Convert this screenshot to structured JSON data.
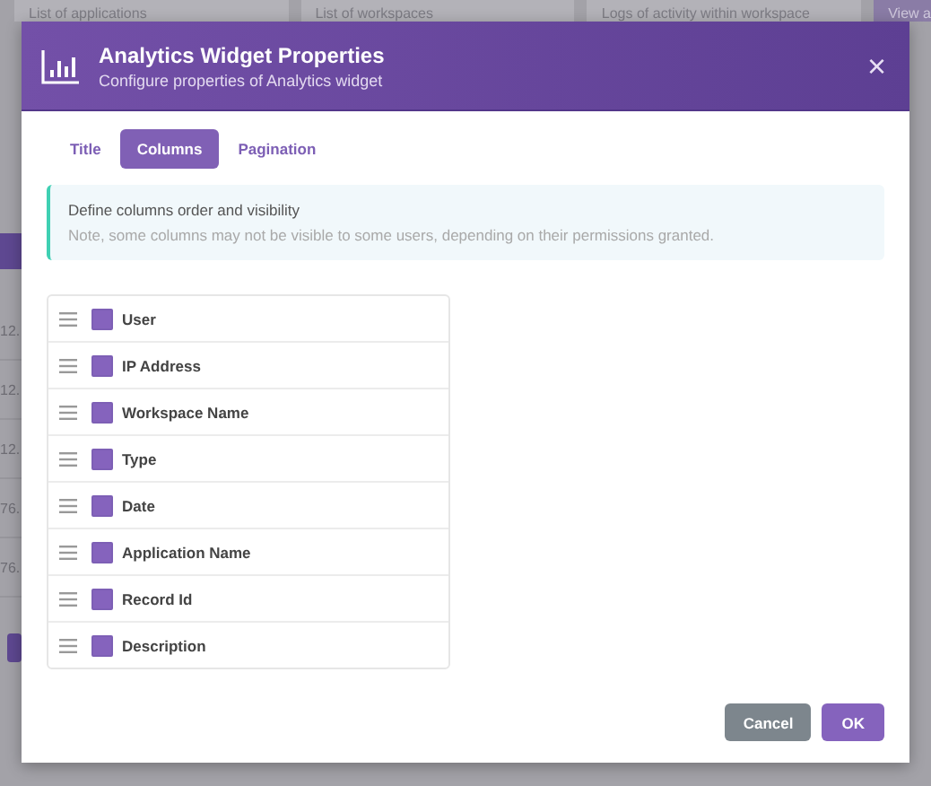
{
  "background": {
    "cards": [
      "List of applications",
      "List of workspaces",
      "Logs of activity within workspace",
      "View a"
    ],
    "side_cells": [
      "12.",
      "12.",
      "12.",
      "76.",
      "76."
    ]
  },
  "dialog": {
    "title": "Analytics Widget Properties",
    "subtitle": "Configure properties of Analytics widget",
    "close": "×"
  },
  "tabs": [
    {
      "label": "Title",
      "selected": false
    },
    {
      "label": "Columns",
      "selected": true
    },
    {
      "label": "Pagination",
      "selected": false
    }
  ],
  "info": {
    "heading": "Define columns order and visibility",
    "note": "Note, some columns may not be visible to some users, depending on their permissions granted."
  },
  "columns": [
    {
      "label": "User",
      "checked": true
    },
    {
      "label": "IP Address",
      "checked": true
    },
    {
      "label": "Workspace Name",
      "checked": true
    },
    {
      "label": "Type",
      "checked": true
    },
    {
      "label": "Date",
      "checked": true
    },
    {
      "label": "Application Name",
      "checked": true
    },
    {
      "label": "Record Id",
      "checked": true
    },
    {
      "label": "Description",
      "checked": true
    }
  ],
  "buttons": [
    {
      "label": "Cancel",
      "kind": "secondary"
    },
    {
      "label": "OK",
      "kind": "primary"
    }
  ]
}
